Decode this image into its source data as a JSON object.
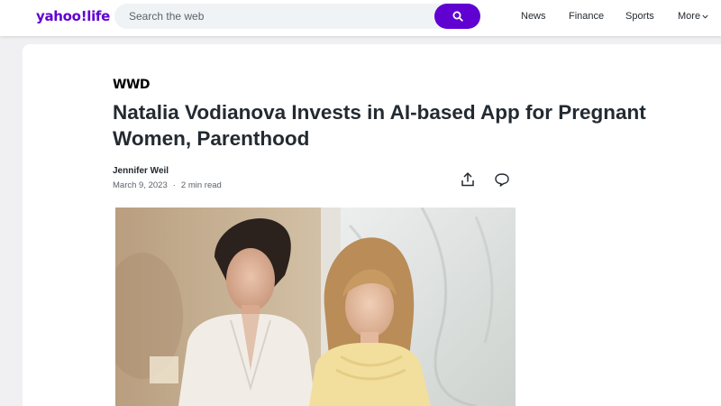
{
  "header": {
    "logo_text": "yahoo!life",
    "search": {
      "placeholder": "Search the web"
    },
    "nav": {
      "news": "News",
      "finance": "Finance",
      "sports": "Sports",
      "more": "More"
    }
  },
  "article": {
    "source": "WWD",
    "title": "Natalia Vodianova Invests in AI-based App for Pregnant Women, Parenthood",
    "author": "Jennifer Weil",
    "date": "March 9, 2023",
    "separator": "·",
    "read_time": "2 min read"
  },
  "colors": {
    "brand": "#6001d2",
    "text": "#232a31",
    "muted": "#5b636a",
    "page_bg": "#f0f0f3"
  },
  "icons": [
    "search-icon",
    "chevron-down-icon",
    "share-icon",
    "comment-icon"
  ]
}
